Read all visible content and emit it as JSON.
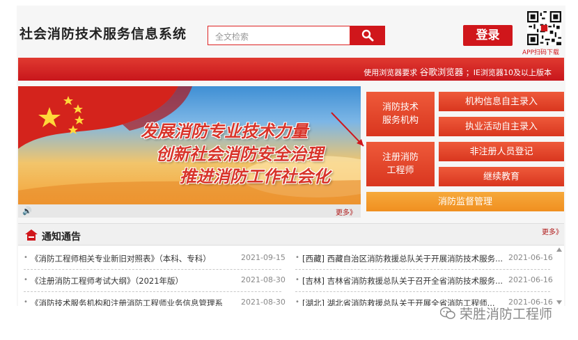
{
  "header": {
    "site_title": "社会消防技术服务信息系统",
    "search_placeholder": "全文检索",
    "login_label": "登录",
    "qr_caption": "APP扫码下载"
  },
  "browser_bar": {
    "prefix": "使用浏览器要求",
    "browser": "谷歌浏览器",
    "suffix": "；IE浏览器10及以上版本"
  },
  "banner": {
    "slogans": [
      "发展消防专业技术力量",
      "创新社会消防安全治理",
      "推进消防工作社会化"
    ],
    "more_label": "更多》"
  },
  "tiles": {
    "service_org": "消防技术\n服务机构",
    "engineer": "注册消防\n工程师",
    "org_entry": "机构信息自主录入",
    "activity_entry": "执业活动自主录入",
    "non_registered": "非注册人员登记",
    "education": "继续教育",
    "supervision": "消防监督管理"
  },
  "notices": {
    "title": "通知通告",
    "more_label": "更多》",
    "left": [
      {
        "text": "《消防工程师相关专业新旧对照表》（本科、专科）",
        "date": "2021-09-15"
      },
      {
        "text": "《注册消防工程师考试大纲》（2021年版）",
        "date": "2021-08-30"
      },
      {
        "text": "《消防技术服务机构和注册消防工程师业务信息管理系",
        "date": "2021-08-30"
      }
    ],
    "right": [
      {
        "text": "[西藏]  西藏自治区消防救援总队关于开展消防技术服务...",
        "date": "2021-06-16"
      },
      {
        "text": "[吉林]  吉林省消防救援总队关于召开全省消防技术服务...",
        "date": "2021-06-16"
      },
      {
        "text": "[湖北]  湖北省消防救援总队关于开展全省消防工程师...",
        "date": "2021-06-16"
      }
    ]
  },
  "watermark": "荣胜消防工程师",
  "colors": {
    "brand_red": "#d0161b",
    "tile_red": "#e2452a",
    "tile_orange": "#f39a2c"
  }
}
